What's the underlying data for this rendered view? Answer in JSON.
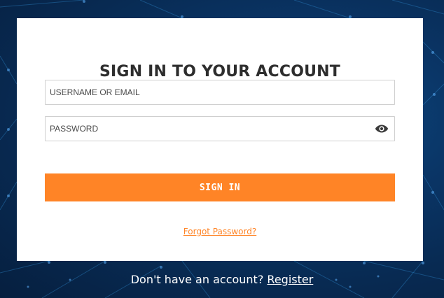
{
  "login": {
    "title": "SIGN IN TO YOUR ACCOUNT",
    "username_placeholder": "USERNAME OR EMAIL",
    "password_placeholder": "PASSWORD",
    "show_password_icon": "eye-icon",
    "signin_label": "SIGN IN",
    "forgot_label": "Forgot Password?"
  },
  "footer": {
    "prompt": "Don't have an account?",
    "register_label": "Register"
  },
  "colors": {
    "accent": "#ff8426",
    "background": "#0a3566",
    "card": "#ffffff",
    "title": "#2d2d2d"
  }
}
